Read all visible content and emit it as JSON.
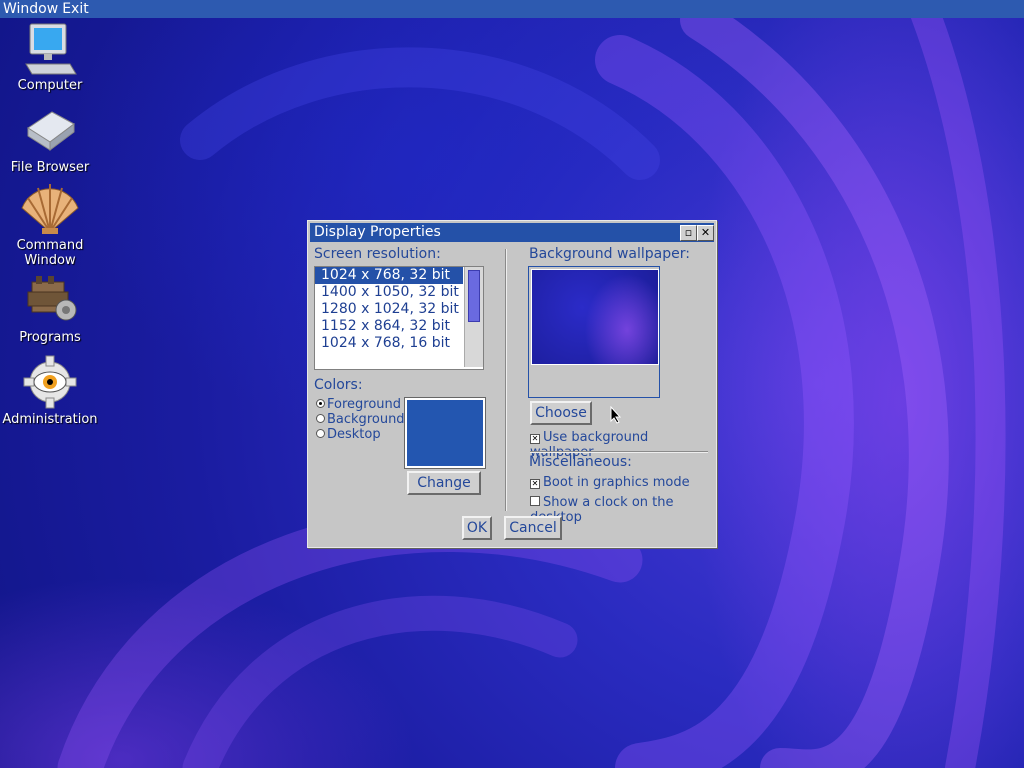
{
  "taskbar": {
    "window_label": "Window",
    "exit_label": "Exit"
  },
  "desktop_icons": [
    {
      "label": "Computer",
      "icon": "computer-icon"
    },
    {
      "label": "File Browser",
      "icon": "file-browser-icon"
    },
    {
      "label_line1": "Command",
      "label_line2": "Window",
      "icon": "shell-icon"
    },
    {
      "label": "Programs",
      "icon": "engine-icon"
    },
    {
      "label": "Administration",
      "icon": "gear-eye-icon"
    }
  ],
  "dialog": {
    "title": "Display Properties",
    "screen_resolution": {
      "label": "Screen resolution:",
      "options": [
        "1024 x 768, 32 bit",
        "1400 x 1050, 32 bit",
        "1280 x 1024, 32 bit",
        "1152 x 864, 32 bit",
        "1024 x 768, 16 bit"
      ],
      "selected": "1024 x 768, 32 bit"
    },
    "colors": {
      "label": "Colors:",
      "options": [
        "Foreground",
        "Background",
        "Desktop"
      ],
      "selected": "Foreground",
      "swatch_color": "#2356b0",
      "change_label": "Change"
    },
    "wallpaper": {
      "label": "Background wallpaper:",
      "choose_label": "Choose",
      "use_label": "Use background wallpaper",
      "use_checked": true
    },
    "misc": {
      "label": "Miscellaneous:",
      "boot_label": "Boot in graphics mode",
      "boot_checked": true,
      "clock_label": "Show a clock on the desktop",
      "clock_checked": false
    },
    "ok_label": "OK",
    "cancel_label": "Cancel"
  },
  "colors": {
    "accent": "#2451a8",
    "dialog_bg": "#c6c6c6",
    "text": "#24489a"
  }
}
